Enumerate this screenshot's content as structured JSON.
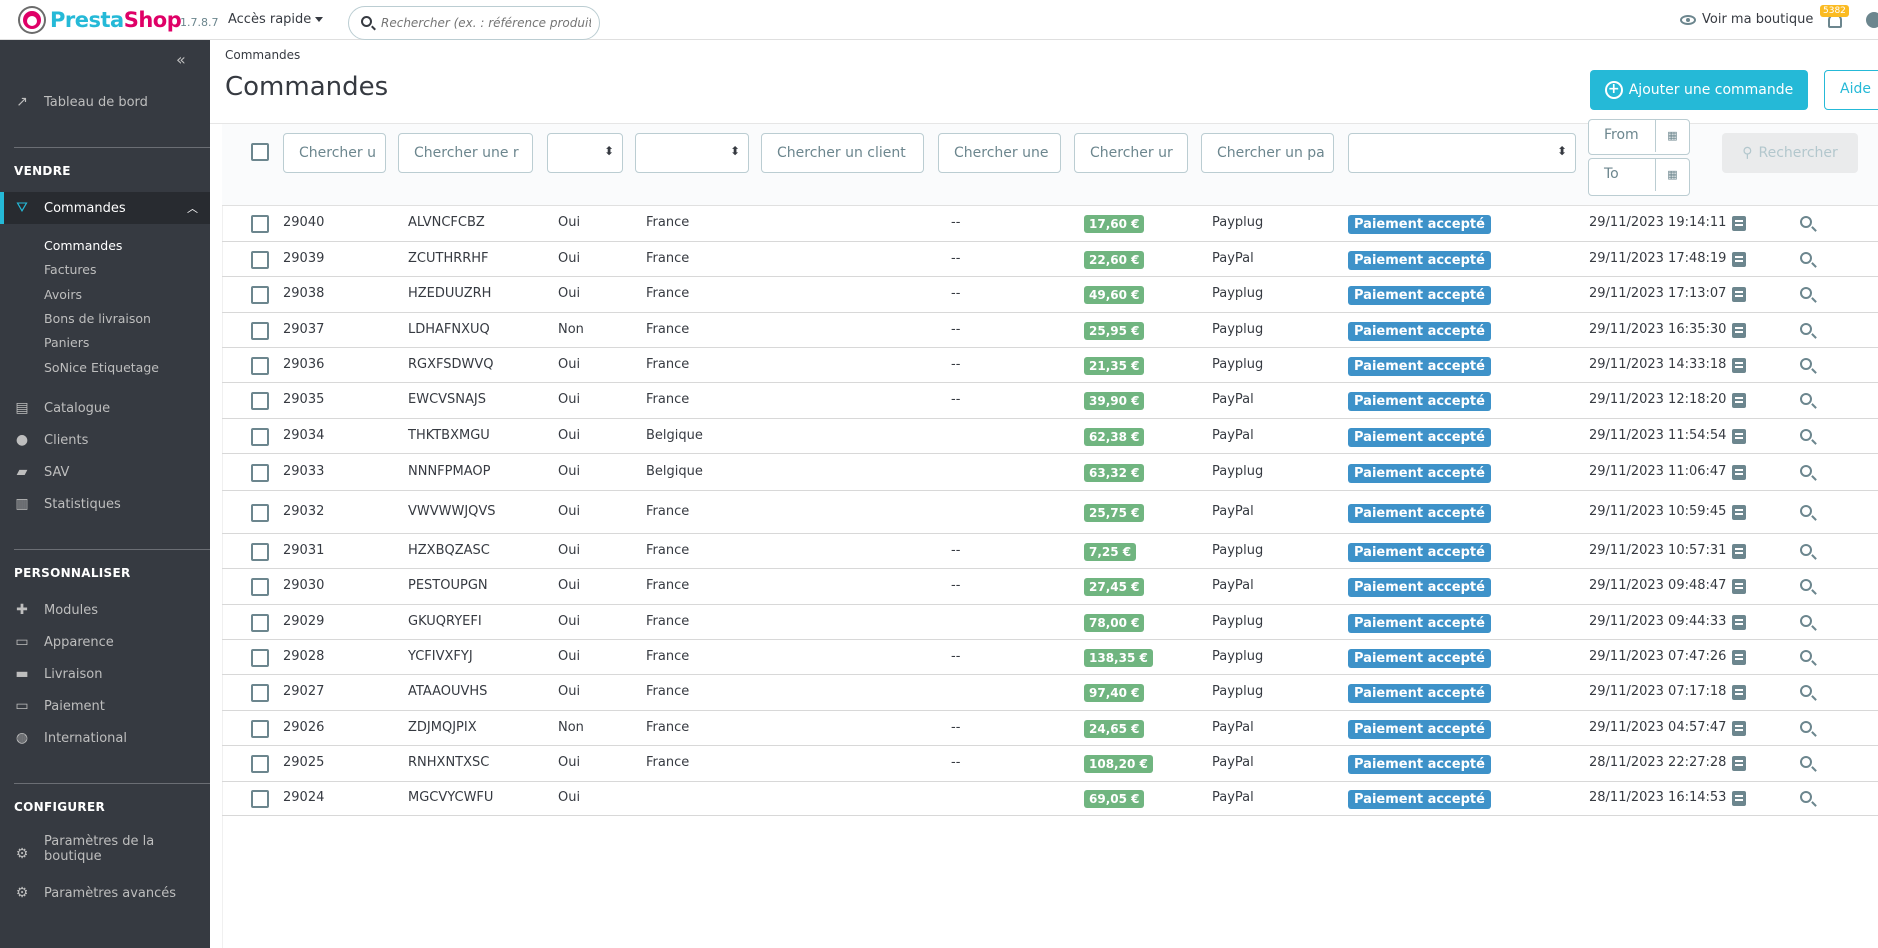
{
  "header": {
    "logo_text_a": "Presta",
    "logo_text_b": "Shop",
    "version": "1.7.8.7",
    "quick_access": "Accès rapide",
    "search_placeholder": "Rechercher (ex. : référence produit, no",
    "view_shop": "Voir ma boutique",
    "notifications": "5382"
  },
  "sidebar": {
    "collapse_icon": "«",
    "dashboard": "Tableau de bord",
    "sell_title": "VENDRE",
    "orders": "Commandes",
    "orders_sub": [
      "Commandes",
      "Factures",
      "Avoirs",
      "Bons de livraison",
      "Paniers",
      "SoNice Etiquetage"
    ],
    "catalog": "Catalogue",
    "customers": "Clients",
    "sav": "SAV",
    "stats": "Statistiques",
    "personalize_title": "PERSONNALISER",
    "modules": "Modules",
    "appearance": "Apparence",
    "shipping": "Livraison",
    "payment": "Paiement",
    "international": "International",
    "configure_title": "CONFIGURER",
    "shop_params_1": "Paramètres de la",
    "shop_params_2": "boutique",
    "advanced_params": "Paramètres avancés"
  },
  "page": {
    "breadcrumb": "Commandes",
    "title": "Commandes",
    "add_order": "Ajouter une commande",
    "help": "Aide"
  },
  "filters": {
    "id": "Chercher u",
    "reference": "Chercher une r",
    "customer": "Chercher un client",
    "carrier": "Chercher une",
    "total": "Chercher ur",
    "payment": "Chercher un pa",
    "from": "From",
    "to": "To",
    "search": "Rechercher"
  },
  "orders": [
    {
      "id": "29040",
      "ref": "ALVNCFCBZ",
      "new": "Oui",
      "country": "France",
      "carrier": "--",
      "total": "17,60 €",
      "payment": "Payplug",
      "status": "Paiement accepté",
      "date": "29/11/2023 19:14:11"
    },
    {
      "id": "29039",
      "ref": "ZCUTHRRHF",
      "new": "Oui",
      "country": "France",
      "carrier": "--",
      "total": "22,60 €",
      "payment": "PayPal",
      "status": "Paiement accepté",
      "date": "29/11/2023 17:48:19"
    },
    {
      "id": "29038",
      "ref": "HZEDUUZRH",
      "new": "Oui",
      "country": "France",
      "carrier": "--",
      "total": "49,60 €",
      "payment": "Payplug",
      "status": "Paiement accepté",
      "date": "29/11/2023 17:13:07"
    },
    {
      "id": "29037",
      "ref": "LDHAFNXUQ",
      "new": "Non",
      "country": "France",
      "carrier": "--",
      "total": "25,95 €",
      "payment": "Payplug",
      "status": "Paiement accepté",
      "date": "29/11/2023 16:35:30"
    },
    {
      "id": "29036",
      "ref": "RGXFSDWVQ",
      "new": "Oui",
      "country": "France",
      "carrier": "--",
      "total": "21,35 €",
      "payment": "Payplug",
      "status": "Paiement accepté",
      "date": "29/11/2023 14:33:18"
    },
    {
      "id": "29035",
      "ref": "EWCVSNAJS",
      "new": "Oui",
      "country": "France",
      "carrier": "--",
      "total": "39,90 €",
      "payment": "PayPal",
      "status": "Paiement accepté",
      "date": "29/11/2023 12:18:20"
    },
    {
      "id": "29034",
      "ref": "THKTBXMGU",
      "new": "Oui",
      "country": "Belgique",
      "carrier": "",
      "total": "62,38 €",
      "payment": "PayPal",
      "status": "Paiement accepté",
      "date": "29/11/2023 11:54:54"
    },
    {
      "id": "29033",
      "ref": "NNNFPMAOP",
      "new": "Oui",
      "country": "Belgique",
      "carrier": "",
      "total": "63,32 €",
      "payment": "Payplug",
      "status": "Paiement accepté",
      "date": "29/11/2023 11:06:47"
    },
    {
      "id": "29032",
      "ref": "VWVWWJQVS",
      "new": "Oui",
      "country": "France",
      "carrier": "",
      "total": "25,75 €",
      "payment": "PayPal",
      "status": "Paiement accepté",
      "date": "29/11/2023 10:59:45"
    },
    {
      "id": "29031",
      "ref": "HZXBQZASC",
      "new": "Oui",
      "country": "France",
      "carrier": "--",
      "total": "7,25 €",
      "payment": "Payplug",
      "status": "Paiement accepté",
      "date": "29/11/2023 10:57:31"
    },
    {
      "id": "29030",
      "ref": "PESTOUPGN",
      "new": "Oui",
      "country": "France",
      "carrier": "--",
      "total": "27,45 €",
      "payment": "PayPal",
      "status": "Paiement accepté",
      "date": "29/11/2023 09:48:47"
    },
    {
      "id": "29029",
      "ref": "GKUQRYEFI",
      "new": "Oui",
      "country": "France",
      "carrier": "",
      "total": "78,00 €",
      "payment": "Payplug",
      "status": "Paiement accepté",
      "date": "29/11/2023 09:44:33"
    },
    {
      "id": "29028",
      "ref": "YCFIVXFYJ",
      "new": "Oui",
      "country": "France",
      "carrier": "--",
      "total": "138,35 €",
      "payment": "Payplug",
      "status": "Paiement accepté",
      "date": "29/11/2023 07:47:26"
    },
    {
      "id": "29027",
      "ref": "ATAAOUVHS",
      "new": "Oui",
      "country": "France",
      "carrier": "",
      "total": "97,40 €",
      "payment": "Payplug",
      "status": "Paiement accepté",
      "date": "29/11/2023 07:17:18"
    },
    {
      "id": "29026",
      "ref": "ZDJMQJPIX",
      "new": "Non",
      "country": "France",
      "carrier": "--",
      "total": "24,65 €",
      "payment": "PayPal",
      "status": "Paiement accepté",
      "date": "29/11/2023 04:57:47"
    },
    {
      "id": "29025",
      "ref": "RNHXNTXSC",
      "new": "Oui",
      "country": "France",
      "carrier": "--",
      "total": "108,20 €",
      "payment": "PayPal",
      "status": "Paiement accepté",
      "date": "28/11/2023 22:27:28"
    },
    {
      "id": "29024",
      "ref": "MGCVYCWFU",
      "new": "Oui",
      "country": "",
      "carrier": "",
      "total": "69,05 €",
      "payment": "PayPal",
      "status": "Paiement accepté",
      "date": "28/11/2023 16:14:53"
    }
  ],
  "colors": {
    "accent": "#25b9d7",
    "price_badge": "#70b580",
    "status_badge": "#3e92c9",
    "sidebar": "#363a41"
  }
}
